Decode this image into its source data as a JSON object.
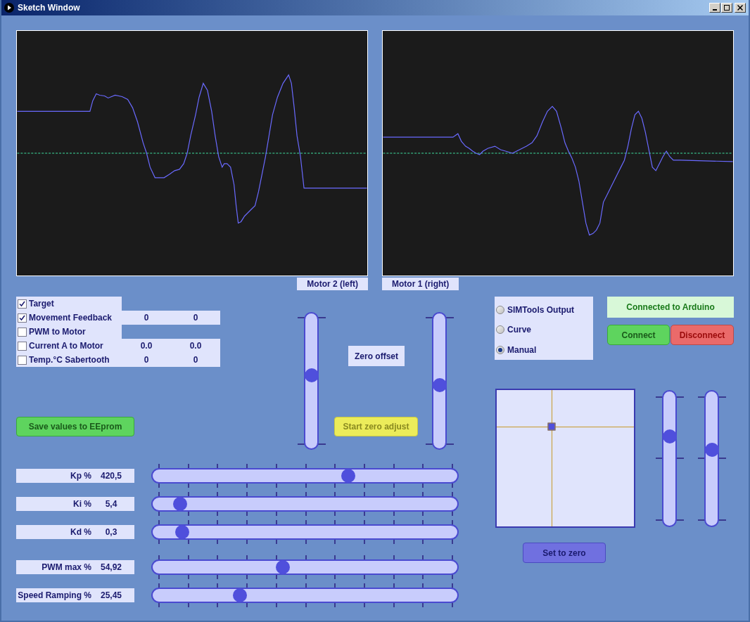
{
  "window": {
    "title": "Sketch Window"
  },
  "plots": [
    {
      "label": "Motor 2 (left)"
    },
    {
      "label": "Motor 1 (right)"
    }
  ],
  "channels": [
    {
      "label": "Target",
      "checked": true
    },
    {
      "label": "Movement Feedback",
      "checked": true,
      "values": [
        "0",
        "0"
      ]
    },
    {
      "label": "PWM to Motor",
      "checked": false
    },
    {
      "label": "Current A to Motor",
      "checked": false,
      "values": [
        "0.0",
        "0.0"
      ]
    },
    {
      "label": "Temp.°C Sabertooth",
      "checked": false,
      "values": [
        "0",
        "0"
      ]
    }
  ],
  "save_button": "Save values to EEprom",
  "zero_sliders": [
    {
      "level": 0.545
    },
    {
      "level": 0.466
    }
  ],
  "zero_offset_label": "Zero offset",
  "zero_adjust_button": "Start zero adjust",
  "gain_sliders": [
    {
      "label": "Kp %",
      "value": "420,5",
      "level": 0.648
    },
    {
      "label": "Ki %",
      "value": "5,4",
      "level": 0.07
    },
    {
      "label": "Kd %",
      "value": "0,3",
      "level": 0.077
    }
  ],
  "output_sliders": [
    {
      "label": "PWM max %",
      "value": "54,92",
      "level": 0.424
    },
    {
      "label": "Speed Ramping %",
      "value": "25,45",
      "level": 0.277
    }
  ],
  "modes": [
    {
      "label": "SIMTools Output",
      "selected": false
    },
    {
      "label": "Curve",
      "selected": false
    },
    {
      "label": "Manual",
      "selected": true
    }
  ],
  "connection": {
    "status": "Connected to Arduino",
    "connect": "Connect",
    "disconnect": "Disconnect"
  },
  "xy_pad": {
    "x": {
      "level": 0.4
    },
    "y": {
      "level": 0.73
    }
  },
  "pad_sliders": [
    {
      "level": 0.68
    },
    {
      "level": 0.57
    }
  ],
  "set_zero_button": "Set to zero"
}
